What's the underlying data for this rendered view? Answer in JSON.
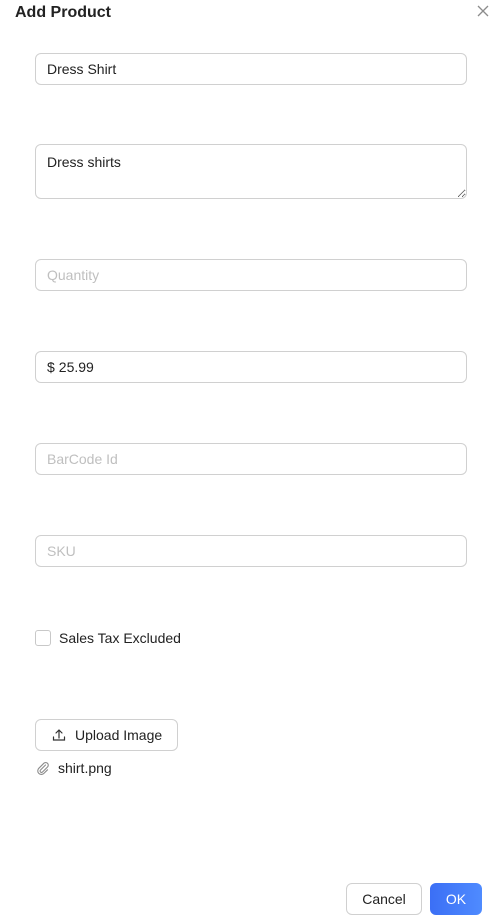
{
  "dialog": {
    "title": "Add Product"
  },
  "form": {
    "name": {
      "value": "Dress Shirt",
      "placeholder": ""
    },
    "description": {
      "value": "Dress shirts",
      "placeholder": ""
    },
    "quantity": {
      "value": "",
      "placeholder": "Quantity"
    },
    "price": {
      "prefix": "$",
      "value": "25.99"
    },
    "barcode": {
      "value": "",
      "placeholder": "BarCode Id"
    },
    "sku": {
      "value": "",
      "placeholder": "SKU"
    },
    "sales_tax_excluded": {
      "label": "Sales Tax Excluded",
      "checked": false
    },
    "upload": {
      "label": "Upload Image",
      "file_name": "shirt.png"
    }
  },
  "footer": {
    "cancel_label": "Cancel",
    "ok_label": "OK"
  },
  "colors": {
    "primary": "#3b6ff5",
    "border": "#d0d0d0"
  }
}
